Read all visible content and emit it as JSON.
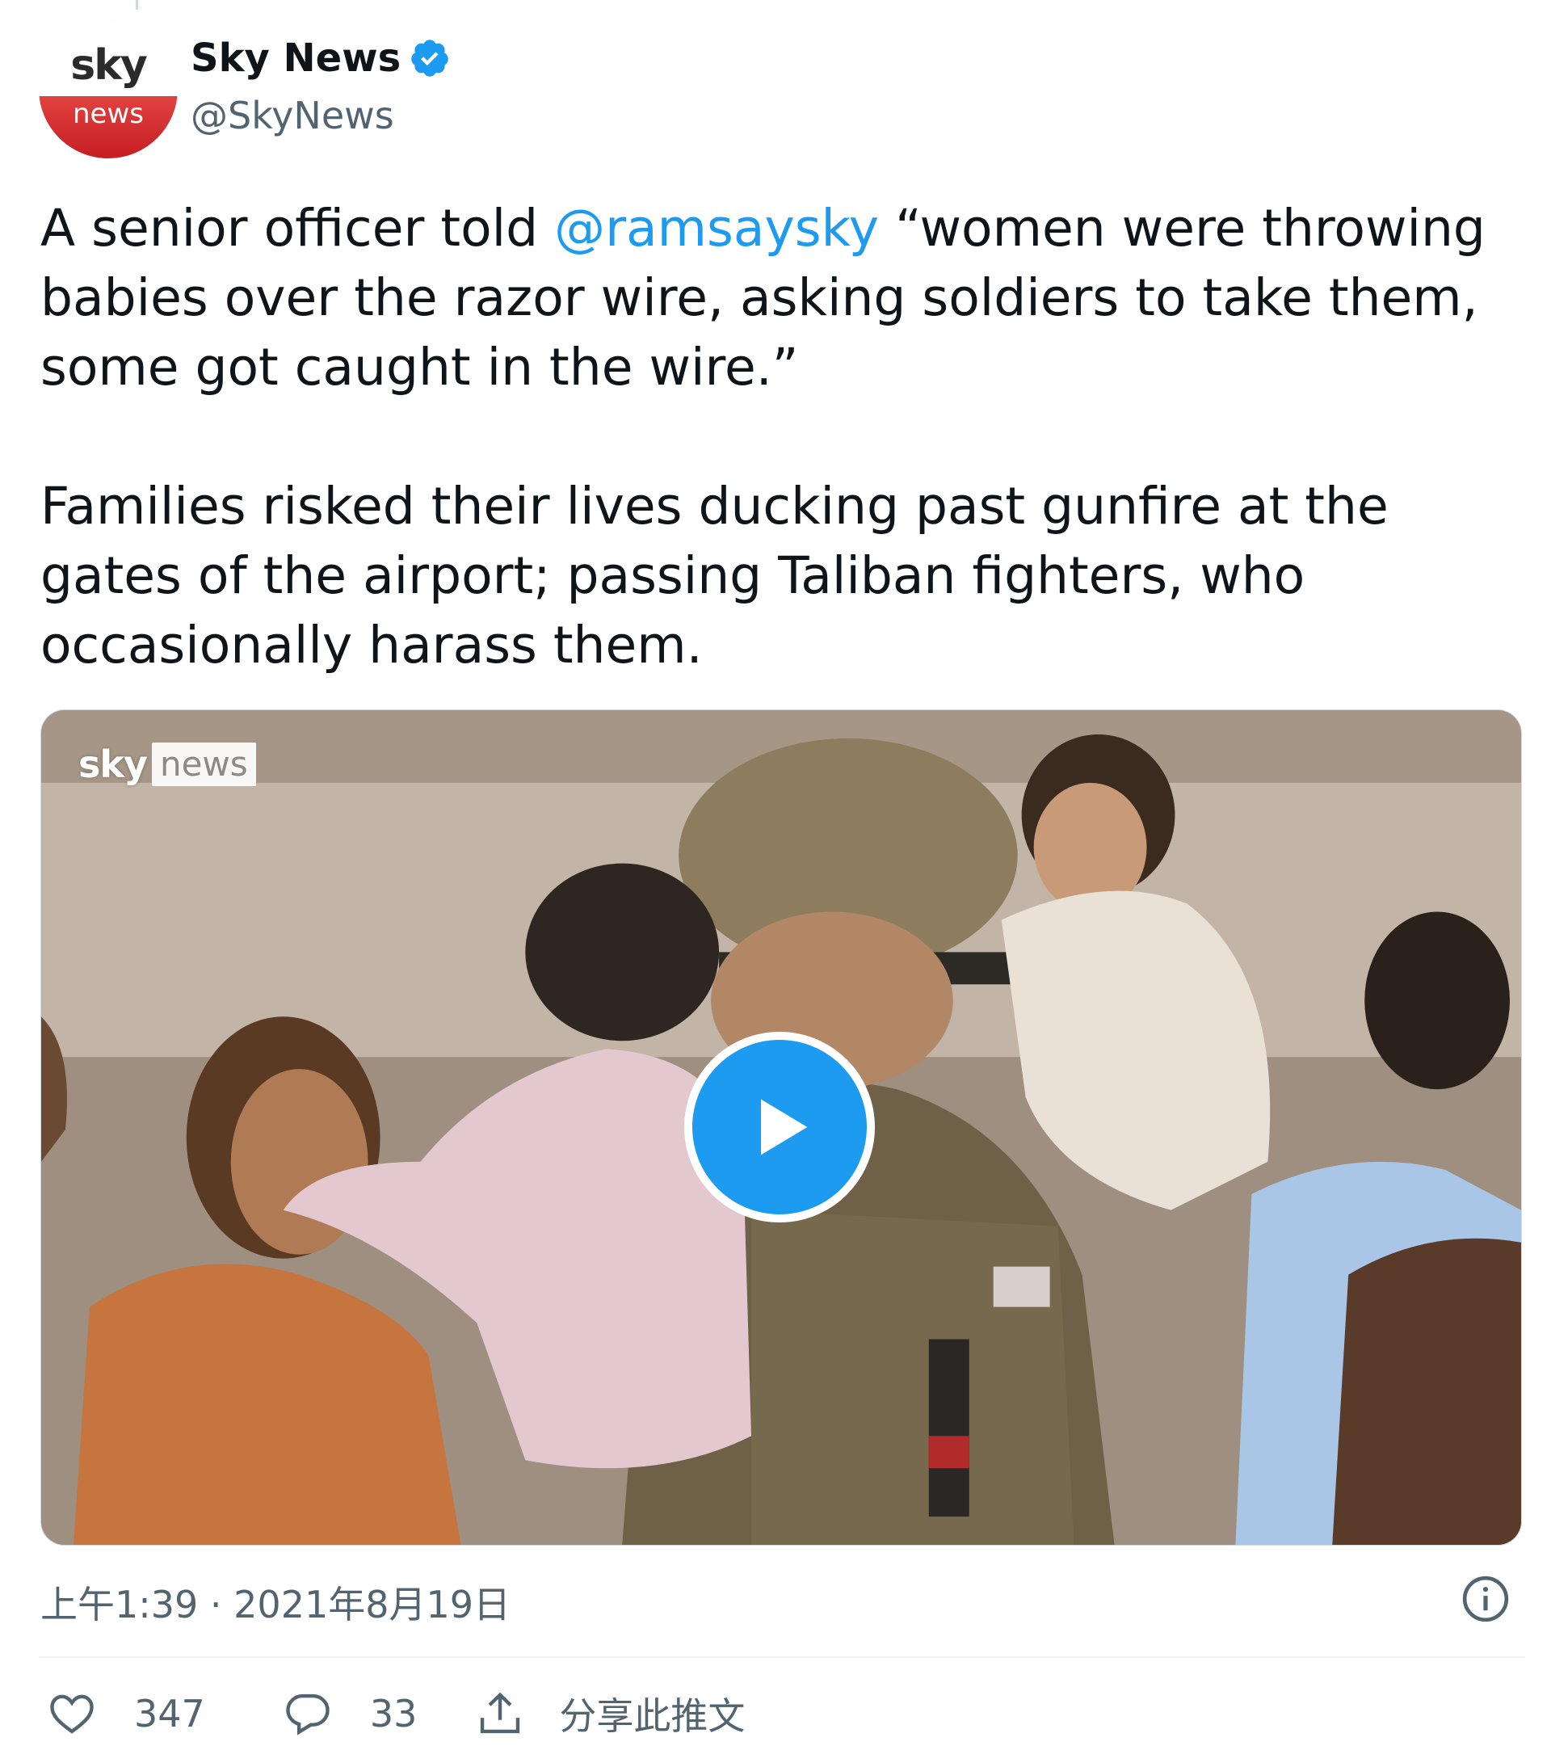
{
  "author": {
    "name": "Sky News",
    "handle": "@SkyNews",
    "avatar_text_top": "sky",
    "avatar_text_bottom": "news",
    "verified_icon": "verified-badge-icon"
  },
  "tweet": {
    "paragraph1_before": "A senior officer told ",
    "mention": "@ramsaysky",
    "paragraph1_after": " “women were throwing babies over the razor wire, asking soldiers to take them, some got caught in the wire.”",
    "paragraph2": "Families risked their lives ducking past gunfire at the gates of the airport; passing Taliban fighters, who occasionally harass them."
  },
  "media": {
    "watermark_sky": "sky",
    "watermark_news": "news",
    "play_icon": "play-icon"
  },
  "timestamp": "上午1:39 · 2021年8月19日",
  "actions": {
    "likes": "347",
    "replies": "33",
    "share_label": "分享此推文"
  },
  "colors": {
    "accent": "#1d9bf0",
    "text": "#0f1419",
    "secondary": "#536471",
    "brand_red": "#c71d24"
  }
}
